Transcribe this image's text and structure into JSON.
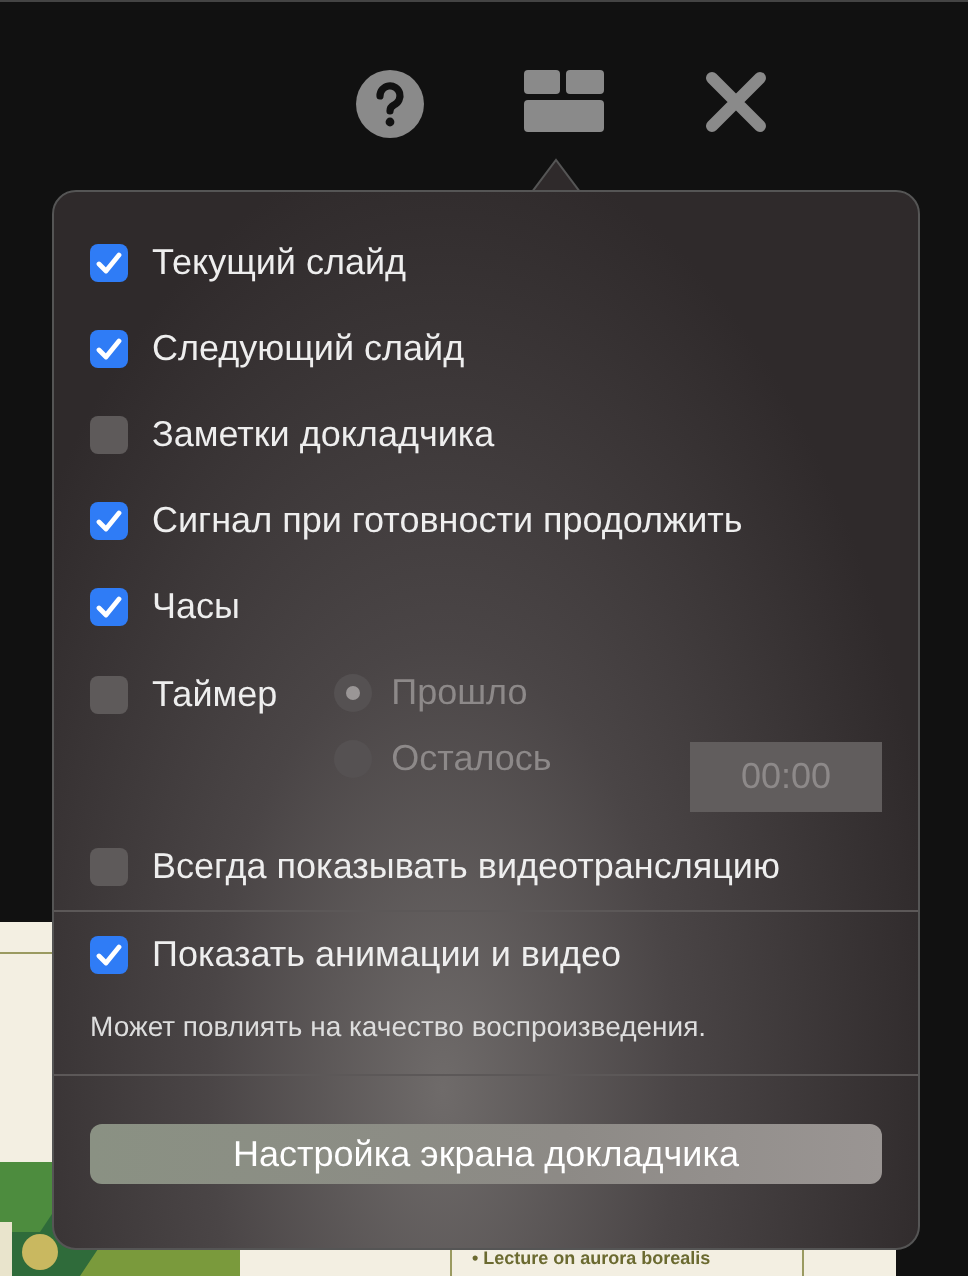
{
  "slide": {
    "text": "• Lecture on aurora borealis"
  },
  "sections": [
    {
      "items": [
        {
          "kind": "checkbox",
          "label": "Текущий слайд",
          "checked": true
        },
        {
          "kind": "checkbox",
          "label": "Следующий слайд",
          "checked": true
        },
        {
          "kind": "checkbox",
          "label": "Заметки докладчика",
          "checked": false
        },
        {
          "kind": "checkbox",
          "label": "Сигнал при готовности продолжить",
          "checked": true
        },
        {
          "kind": "checkbox",
          "label": "Часы",
          "checked": true
        },
        {
          "kind": "timer",
          "label": "Таймер",
          "checked": false,
          "modes": [
            {
              "label": "Прошло",
              "selected": true
            },
            {
              "label": "Осталось",
              "selected": false
            }
          ],
          "time": "00:00"
        },
        {
          "kind": "checkbox",
          "label": "Всегда показывать видеотрансляцию",
          "checked": false
        }
      ]
    },
    {
      "items": [
        {
          "kind": "checkbox",
          "label": "Показать анимации и видео",
          "checked": true,
          "note": "Может повлиять на качество воспроизведения."
        }
      ]
    }
  ],
  "button": "Настройка экрана докладчика"
}
